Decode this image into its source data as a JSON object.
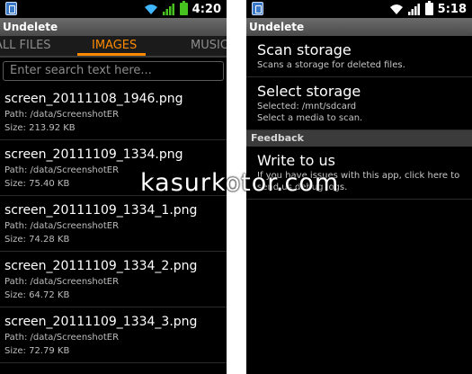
{
  "left_phone": {
    "status": {
      "time": "4:20"
    },
    "app_title": "Undelete",
    "tabs": [
      {
        "label": "ALL FILES",
        "active": false
      },
      {
        "label": "IMAGES",
        "active": true
      },
      {
        "label": "MUSIC",
        "active": false
      }
    ],
    "search": {
      "placeholder": "Enter search text here..."
    },
    "files": [
      {
        "name": "screen_20111108_1946.png",
        "path": "Path: /data/ScreenshotER",
        "size": "Size: 213.92 KB"
      },
      {
        "name": "screen_20111109_1334.png",
        "path": "Path: /data/ScreenshotER",
        "size": "Size: 75.40 KB"
      },
      {
        "name": "screen_20111109_1334_1.png",
        "path": "Path: /data/ScreenshotER",
        "size": "Size: 74.28 KB"
      },
      {
        "name": "screen_20111109_1334_2.png",
        "path": "Path: /data/ScreenshotER",
        "size": "Size: 64.72 KB"
      },
      {
        "name": "screen_20111109_1334_3.png",
        "path": "Path: /data/ScreenshotER",
        "size": "Size: 72.79 KB"
      }
    ]
  },
  "right_phone": {
    "status": {
      "time": "5:18"
    },
    "app_title": "Undelete",
    "settings": [
      {
        "title": "Scan storage",
        "summary": [
          "Scans a storage for deleted files."
        ]
      },
      {
        "title": "Select storage",
        "summary": [
          "Selected: /mnt/sdcard",
          "Select a media to scan."
        ]
      }
    ],
    "category": "Feedback",
    "feedback": {
      "title": "Write to us",
      "summary": [
        "If you have issues with this app, click here to",
        "send us debug logs."
      ]
    }
  },
  "watermark": "kasurkotor.com",
  "colors": {
    "accent": "#ff8a00",
    "battery_left": "#46c31e",
    "wifi": "#3fb6ff"
  }
}
